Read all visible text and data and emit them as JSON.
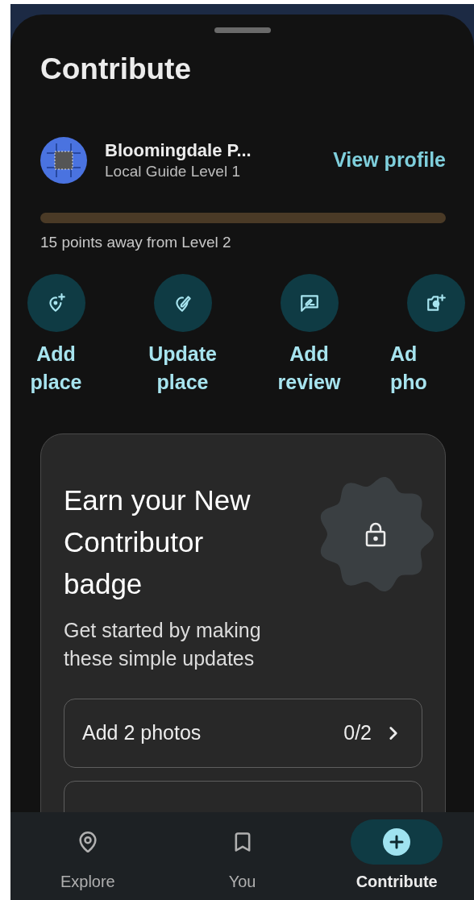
{
  "sheet": {
    "title": "Contribute"
  },
  "profile": {
    "name": "Bloomingdale P...",
    "subtitle": "Local Guide Level 1",
    "action": "View profile"
  },
  "progress": {
    "level": 0,
    "caption": "15 points away from Level 2"
  },
  "actions": [
    {
      "kind": "add-place",
      "lines": [
        "Add",
        "place"
      ],
      "clipped": false
    },
    {
      "kind": "update-place",
      "lines": [
        "Update",
        "place"
      ],
      "clipped": false
    },
    {
      "kind": "add-review",
      "lines": [
        "Add",
        "review"
      ],
      "clipped": false
    },
    {
      "kind": "add-photo",
      "lines": [
        "Ad",
        "pho"
      ],
      "clipped": true
    }
  ],
  "badge_card": {
    "title": "Earn your New Contributor badge",
    "subtitle": "Get started by making these simple updates",
    "locked": true,
    "tasks": [
      {
        "label": "Add 2 photos",
        "count": "0/2"
      }
    ]
  },
  "nav": [
    {
      "kind": "explore",
      "label": "Explore",
      "selected": false
    },
    {
      "kind": "you",
      "label": "You",
      "selected": false
    },
    {
      "kind": "contribute",
      "label": "Contribute",
      "selected": true
    }
  ]
}
